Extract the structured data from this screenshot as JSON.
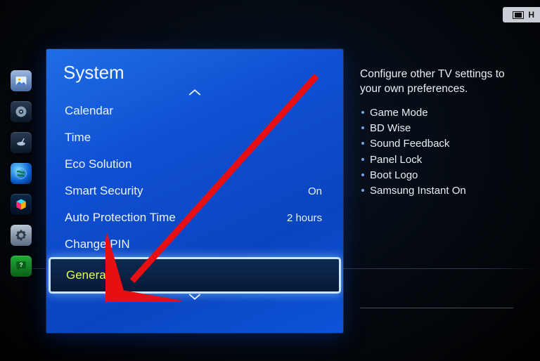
{
  "badge": {
    "label": "H"
  },
  "rail": {
    "items": [
      {
        "name": "picture",
        "icon": "picture-icon"
      },
      {
        "name": "sound",
        "icon": "speaker-icon"
      },
      {
        "name": "broadcasting",
        "icon": "satellite-icon"
      },
      {
        "name": "network",
        "icon": "globe-icon"
      },
      {
        "name": "smarthub",
        "icon": "cube-icon"
      },
      {
        "name": "system",
        "icon": "gear-icon"
      },
      {
        "name": "support",
        "icon": "help-icon"
      }
    ]
  },
  "panel": {
    "title": "System",
    "items": [
      {
        "label": "Calendar",
        "value": ""
      },
      {
        "label": "Time",
        "value": ""
      },
      {
        "label": "Eco Solution",
        "value": ""
      },
      {
        "label": "Smart Security",
        "value": "On"
      },
      {
        "label": "Auto Protection Time",
        "value": "2 hours"
      },
      {
        "label": "Change PIN",
        "value": ""
      },
      {
        "label": "General",
        "value": "",
        "selected": true
      }
    ]
  },
  "description": {
    "text": "Configure other TV settings to your own preferences.",
    "bullets": [
      "Game Mode",
      "BD Wise",
      "Sound Feedback",
      "Panel Lock",
      "Boot Logo",
      "Samsung Instant On"
    ]
  },
  "annotation": {
    "kind": "arrow",
    "target": "General"
  }
}
